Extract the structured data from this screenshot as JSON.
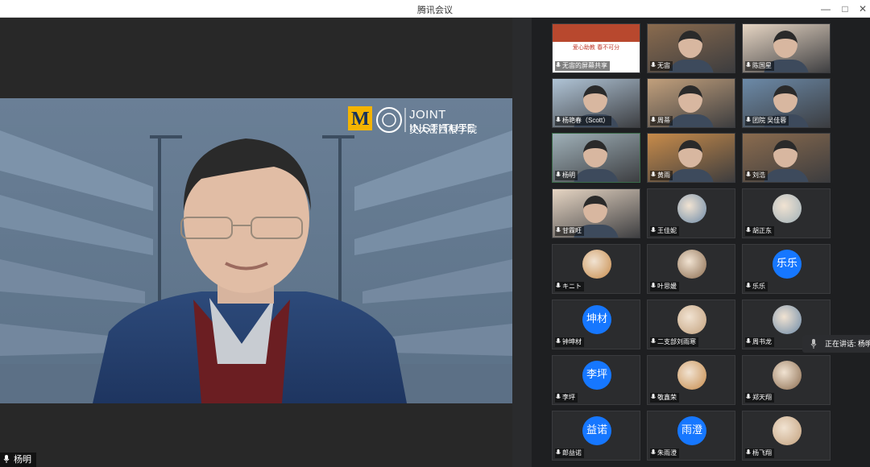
{
  "window": {
    "title": "腾讯会议"
  },
  "main_video": {
    "speaker_name": "杨明",
    "background_logo_text": "JOINT INSTITUTE",
    "background_logo_subtext": "交大密西根学院"
  },
  "speaking_indicator": {
    "text": "正在讲话: 杨明"
  },
  "participants": [
    {
      "name": "无宙的屏幕共享",
      "type": "screen-share",
      "share_title": "爱心助教 春不可分"
    },
    {
      "name": "无宙",
      "type": "video"
    },
    {
      "name": "陈国星",
      "type": "video"
    },
    {
      "name": "杨艳春（Scott）",
      "type": "video"
    },
    {
      "name": "周蒂",
      "type": "video"
    },
    {
      "name": "团院 吴佳蓉",
      "type": "video"
    },
    {
      "name": "杨明",
      "type": "video",
      "active": true
    },
    {
      "name": "黄雨",
      "type": "video"
    },
    {
      "name": "刘浩",
      "type": "video"
    },
    {
      "name": "甘霖旺",
      "type": "video"
    },
    {
      "name": "王佳妮",
      "type": "avatar-photo"
    },
    {
      "name": "胡正东",
      "type": "avatar-photo"
    },
    {
      "name": "キニト",
      "type": "avatar-photo"
    },
    {
      "name": "叶思媛",
      "type": "avatar-photo"
    },
    {
      "name": "乐乐",
      "type": "avatar-text",
      "avatar_text": "乐乐"
    },
    {
      "name": "钟坤材",
      "type": "avatar-text",
      "avatar_text": "坤材"
    },
    {
      "name": "二支部刘雨寒",
      "type": "avatar-photo"
    },
    {
      "name": "周书龙",
      "type": "avatar-photo"
    },
    {
      "name": "李坪",
      "type": "avatar-text",
      "avatar_text": "李坪"
    },
    {
      "name": "敬鑫荣",
      "type": "avatar-photo"
    },
    {
      "name": "郑天翔",
      "type": "avatar-photo"
    },
    {
      "name": "郎益诺",
      "type": "avatar-text",
      "avatar_text": "益诺"
    },
    {
      "name": "朱雨澄",
      "type": "avatar-text",
      "avatar_text": "雨澄"
    },
    {
      "name": "杨飞翔",
      "type": "avatar-photo"
    }
  ],
  "colors": {
    "avatar_blue": "#1677ff",
    "active_border": "#3a6b49",
    "background": "#1e1f21"
  }
}
